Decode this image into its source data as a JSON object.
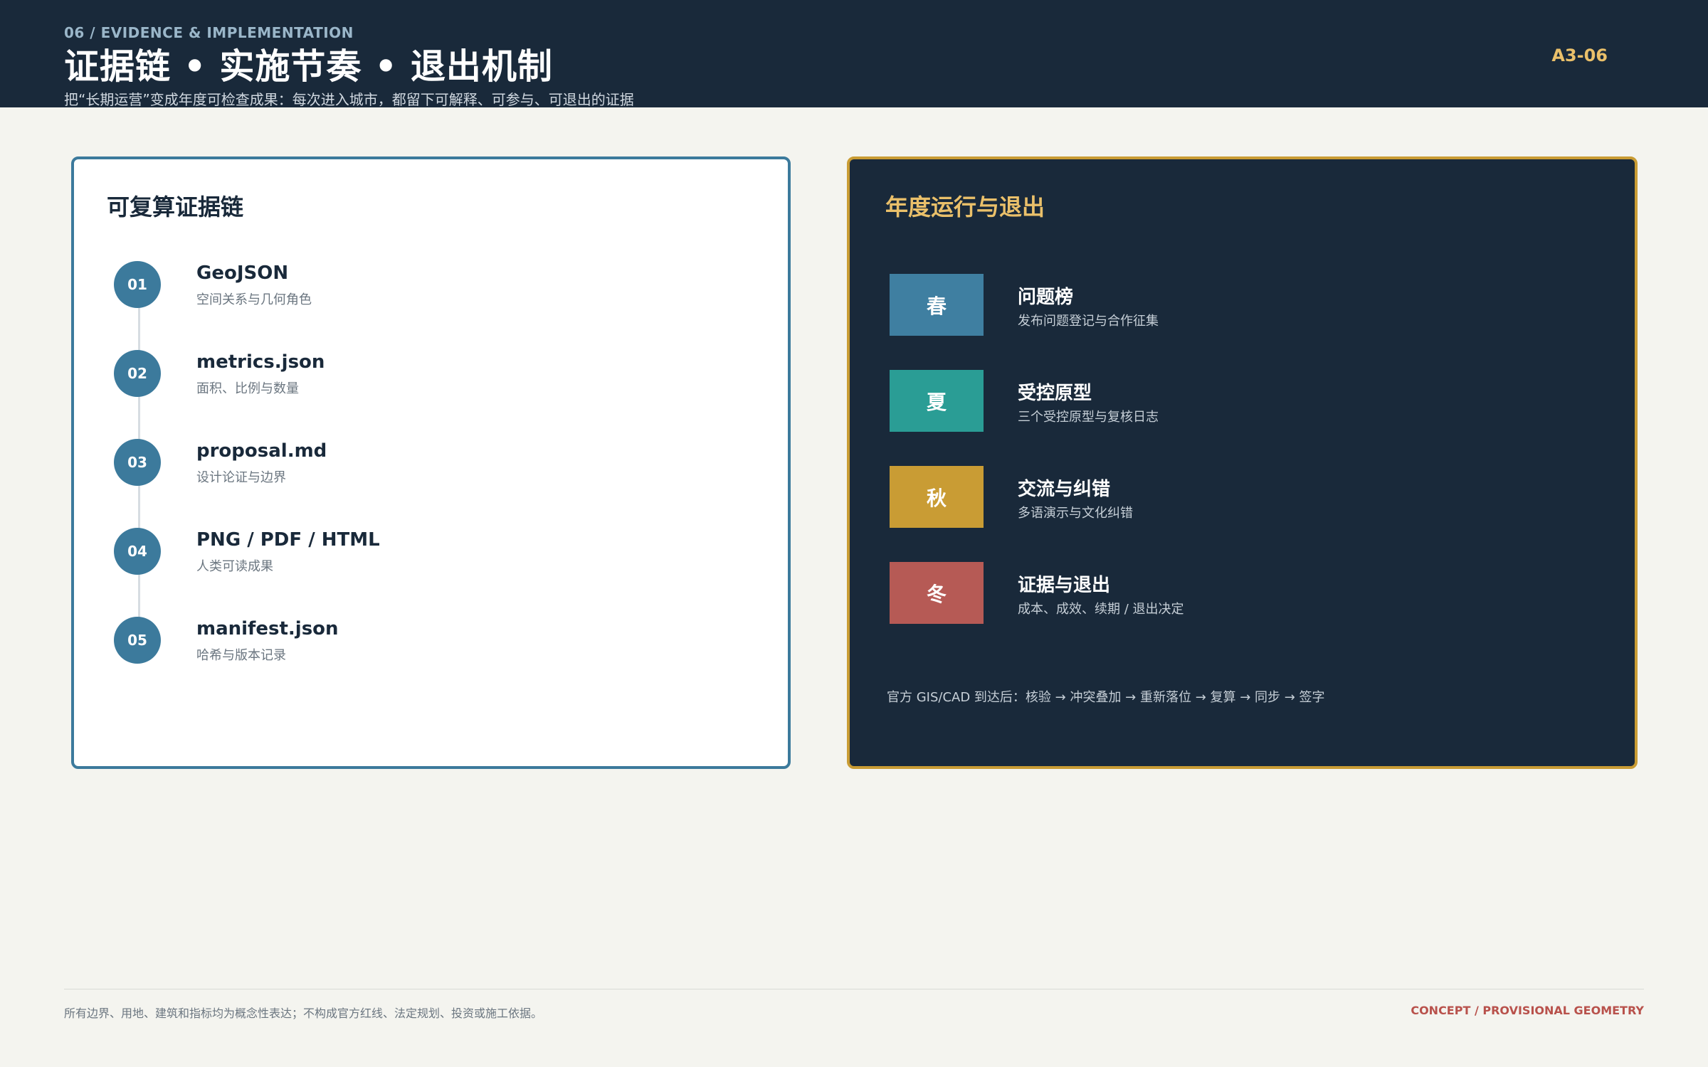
{
  "header": {
    "eyebrow": "06 / EVIDENCE & IMPLEMENTATION",
    "title": "证据链 • 实施节奏 • 退出机制",
    "subtitle": "把“长期运营”变成年度可检查成果：每次进入城市，都留下可解释、可参与、可退出的证据",
    "code": "A3-06"
  },
  "evidence": {
    "title": "可复算证据链",
    "items": [
      {
        "num": "01",
        "name": "GeoJSON",
        "desc": "空间关系与几何角色"
      },
      {
        "num": "02",
        "name": "metrics.json",
        "desc": "面积、比例与数量"
      },
      {
        "num": "03",
        "name": "proposal.md",
        "desc": "设计论证与边界"
      },
      {
        "num": "04",
        "name": "PNG / PDF / HTML",
        "desc": "人类可读成果"
      },
      {
        "num": "05",
        "name": "manifest.json",
        "desc": "哈希与版本记录"
      }
    ]
  },
  "annual": {
    "title": "年度运行与退出",
    "seasons": [
      {
        "tag": "春",
        "name": "问题榜",
        "desc": "发布问题登记与合作征集",
        "color": "#3f7fa1"
      },
      {
        "tag": "夏",
        "name": "受控原型",
        "desc": "三个受控原型与复核日志",
        "color": "#2a9d95"
      },
      {
        "tag": "秋",
        "name": "交流与纠错",
        "desc": "多语演示与文化纠错",
        "color": "#c99c34"
      },
      {
        "tag": "冬",
        "name": "证据与退出",
        "desc": "成本、成效、续期 / 退出决定",
        "color": "#b65a55"
      }
    ],
    "note": "官方 GIS/CAD 到达后：核验 → 冲突叠加 → 重新落位 → 复算 → 同步 → 签字"
  },
  "footer": {
    "disclaimer": "所有边界、用地、建筑和指标均为概念性表达；不构成官方红线、法定规划、投资或施工依据。",
    "status": "CONCEPT / PROVISIONAL GEOMETRY"
  }
}
